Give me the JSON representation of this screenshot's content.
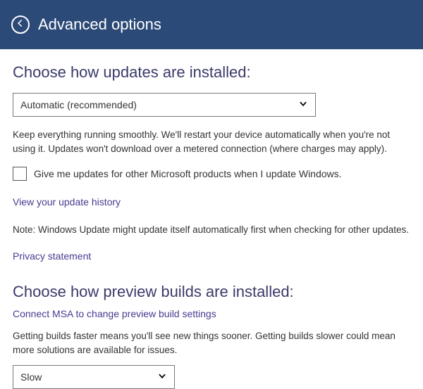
{
  "header": {
    "title": "Advanced options"
  },
  "updates": {
    "section_title": "Choose how updates are installed:",
    "dropdown_value": "Automatic (recommended)",
    "description": "Keep everything running smoothly. We'll restart your device automatically when you're not using it. Updates won't download over a metered connection (where charges may apply).",
    "checkbox_label": "Give me updates for other Microsoft products when I update Windows.",
    "history_link": "View your update history",
    "note": "Note: Windows Update might update itself automatically first when checking for other updates.",
    "privacy_link": "Privacy statement"
  },
  "preview": {
    "section_title": "Choose how preview builds are installed:",
    "msa_link": "Connect MSA to change preview build settings",
    "description": "Getting builds faster means you'll see new things sooner. Getting builds slower could mean more solutions are available for issues.",
    "dropdown_value": "Slow"
  }
}
